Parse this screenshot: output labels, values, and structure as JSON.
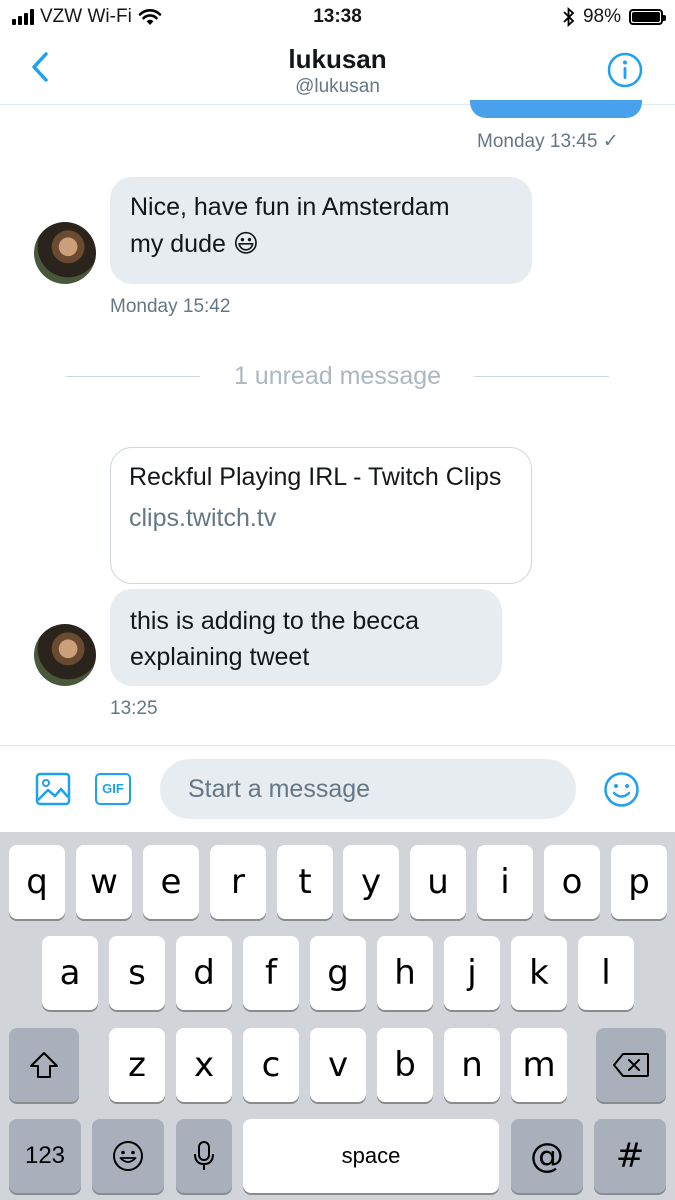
{
  "status_bar": {
    "carrier": "VZW Wi-Fi",
    "time": "13:38",
    "battery": "98%",
    "battery_level": 0.98
  },
  "header": {
    "name": "lukusan",
    "handle": "@lukusan"
  },
  "messages": {
    "sent_time": "Monday 13:45 ✓",
    "msg1_line1": "Nice, have fun in Amsterdam",
    "msg1_line2": "my dude 😃",
    "msg1_time": "Monday 15:42",
    "unread": "1 unread message",
    "link_title": "Reckful Playing IRL - Twitch Clips",
    "link_url": "clips.twitch.tv",
    "msg2_text": "this is adding to the becca explaining tweet",
    "msg2_time": "13:25"
  },
  "composer": {
    "gif_label": "GIF",
    "placeholder": "Start a message"
  },
  "keyboard": {
    "row1": [
      "q",
      "w",
      "e",
      "r",
      "t",
      "y",
      "u",
      "i",
      "o",
      "p"
    ],
    "row2": [
      "a",
      "s",
      "d",
      "f",
      "g",
      "h",
      "j",
      "k",
      "l"
    ],
    "row3": [
      "z",
      "x",
      "c",
      "v",
      "b",
      "n",
      "m"
    ],
    "numbers": "123",
    "space": "space",
    "at": "@",
    "hash": "#"
  },
  "colors": {
    "accent": "#1da1f2",
    "sent_bubble": "#4aa1eb",
    "received_bubble": "#e6ecf0",
    "secondary_text": "#657786"
  }
}
